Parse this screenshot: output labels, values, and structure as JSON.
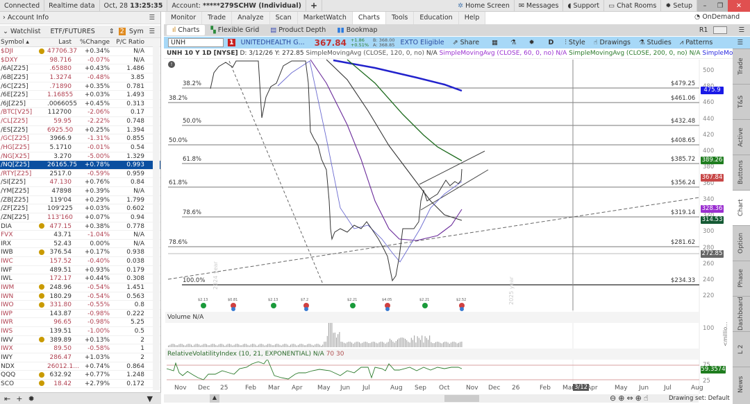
{
  "topbar": {
    "connected": "Connected",
    "realtime": "Realtime data",
    "date": "Oct, 28",
    "time": "13:25:35",
    "account_label": "Account:",
    "account": "*****279SCHW (Individual)",
    "home": "Home Screen",
    "messages": "Messages",
    "support": "Support",
    "chat": "Chat Rooms",
    "setup": "Setup"
  },
  "left": {
    "account_info": "Account Info",
    "watchlist": "Watchlist",
    "list_name": "ETF/FUTURES",
    "badge": "2",
    "sym": "Sym",
    "headers": [
      "Symbol ▴",
      "Last",
      "%Change",
      "P/C Ratio"
    ],
    "rows": [
      {
        "s": "$DJI",
        "b": true,
        "l": "47706.37",
        "c": "+0.34%",
        "p": "N/A",
        "lr": 1,
        "sr": 1
      },
      {
        "s": "$DXY",
        "b": false,
        "l": "98.716",
        "c": "-0.07%",
        "p": "N/A",
        "lr": 1,
        "sr": 1
      },
      {
        "s": "/6A[Z25]",
        "b": false,
        "l": ".65880",
        "c": "+0.43%",
        "p": "1.486",
        "lr": 1,
        "sr": 0
      },
      {
        "s": "/6B[Z25]",
        "b": false,
        "l": "1.3274",
        "c": "-0.48%",
        "p": "3.85",
        "lr": 1,
        "sr": 0
      },
      {
        "s": "/6C[Z25]",
        "b": false,
        "l": ".71890",
        "c": "+0.35%",
        "p": "0.781",
        "lr": 1,
        "sr": 0
      },
      {
        "s": "/6E[Z25]",
        "b": false,
        "l": "1.16855",
        "c": "+0.03%",
        "p": "1.493",
        "lr": 1,
        "sr": 0
      },
      {
        "s": "/6J[Z25]",
        "b": false,
        "l": ".0066055",
        "c": "+0.45%",
        "p": "0.313",
        "lr": 0,
        "sr": 0
      },
      {
        "s": "/BTC[V25]",
        "b": false,
        "l": "112700",
        "c": "-2.06%",
        "p": "0.17",
        "lr": 0,
        "sr": 1
      },
      {
        "s": "/CL[Z25]",
        "b": false,
        "l": "59.95",
        "c": "-2.22%",
        "p": "0.748",
        "lr": 1,
        "sr": 1
      },
      {
        "s": "/ES[Z25]",
        "b": false,
        "l": "6925.50",
        "c": "+0.25%",
        "p": "1.394",
        "lr": 1,
        "sr": 0
      },
      {
        "s": "/GC[Z25]",
        "b": false,
        "l": "3966.9",
        "c": "-1.31%",
        "p": "0.855",
        "lr": 0,
        "sr": 1
      },
      {
        "s": "/HG[Z25]",
        "b": false,
        "l": "5.1710",
        "c": "-0.01%",
        "p": "0.54",
        "lr": 0,
        "sr": 1
      },
      {
        "s": "/NG[X25]",
        "b": false,
        "l": "3.270",
        "c": "-5.00%",
        "p": "1.329",
        "lr": 0,
        "sr": 1
      },
      {
        "s": "/NQ[Z25]",
        "b": false,
        "l": "26165.75",
        "c": "+0.78%",
        "p": "0.993",
        "lr": 0,
        "sr": 0,
        "sel": true
      },
      {
        "s": "/RTY[Z25]",
        "b": false,
        "l": "2517.0",
        "c": "-0.59%",
        "p": "0.959",
        "lr": 0,
        "sr": 1
      },
      {
        "s": "/SI[Z25]",
        "b": false,
        "l": "47.130",
        "c": "+0.76%",
        "p": "0.84",
        "lr": 1,
        "sr": 0
      },
      {
        "s": "/YM[Z25]",
        "b": false,
        "l": "47898",
        "c": "+0.39%",
        "p": "N/A",
        "lr": 0,
        "sr": 0
      },
      {
        "s": "/ZB[Z25]",
        "b": false,
        "l": "119'04",
        "c": "+0.29%",
        "p": "1.799",
        "lr": 0,
        "sr": 0
      },
      {
        "s": "/ZF[Z25]",
        "b": false,
        "l": "109'225",
        "c": "+0.03%",
        "p": "0.602",
        "lr": 0,
        "sr": 0
      },
      {
        "s": "/ZN[Z25]",
        "b": false,
        "l": "113'160",
        "c": "+0.07%",
        "p": "0.94",
        "lr": 1,
        "sr": 0
      },
      {
        "s": "DIA",
        "b": true,
        "l": "477.15",
        "c": "+0.38%",
        "p": "0.778",
        "lr": 1,
        "sr": 0
      },
      {
        "s": "FVX",
        "b": false,
        "l": "43.71",
        "c": "-1.04%",
        "p": "N/A",
        "lr": 0,
        "sr": 1
      },
      {
        "s": "IRX",
        "b": false,
        "l": "52.43",
        "c": "0.00%",
        "p": "N/A",
        "lr": 0,
        "sr": 0
      },
      {
        "s": "IWB",
        "b": true,
        "l": "376.54",
        "c": "+0.17%",
        "p": "0.938",
        "lr": 0,
        "sr": 0
      },
      {
        "s": "IWC",
        "b": false,
        "l": "157.52",
        "c": "-0.40%",
        "p": "0.038",
        "lr": 1,
        "sr": 1
      },
      {
        "s": "IWF",
        "b": false,
        "l": "489.51",
        "c": "+0.93%",
        "p": "0.179",
        "lr": 0,
        "sr": 0
      },
      {
        "s": "IWL",
        "b": false,
        "l": "172.17",
        "c": "+0.44%",
        "p": "0.308",
        "lr": 1,
        "sr": 0
      },
      {
        "s": "IWM",
        "b": true,
        "l": "248.96",
        "c": "-0.54%",
        "p": "1.451",
        "lr": 0,
        "sr": 1
      },
      {
        "s": "IWN",
        "b": true,
        "l": "180.29",
        "c": "-0.54%",
        "p": "0.563",
        "lr": 0,
        "sr": 1
      },
      {
        "s": "IWO",
        "b": true,
        "l": "331.80",
        "c": "-0.55%",
        "p": "0.8",
        "lr": 1,
        "sr": 1
      },
      {
        "s": "IWP",
        "b": false,
        "l": "143.87",
        "c": "-0.98%",
        "p": "0.222",
        "lr": 0,
        "sr": 1
      },
      {
        "s": "IWR",
        "b": false,
        "l": "96.65",
        "c": "-0.98%",
        "p": "5.25",
        "lr": 1,
        "sr": 1
      },
      {
        "s": "IWS",
        "b": false,
        "l": "139.51",
        "c": "-1.00%",
        "p": "0.5",
        "lr": 0,
        "sr": 1
      },
      {
        "s": "IWV",
        "b": true,
        "l": "389.89",
        "c": "+0.13%",
        "p": "2",
        "lr": 0,
        "sr": 0
      },
      {
        "s": "IWX",
        "b": false,
        "l": "89.50",
        "c": "-0.58%",
        "p": "1",
        "lr": 1,
        "sr": 1
      },
      {
        "s": "IWY",
        "b": false,
        "l": "286.47",
        "c": "+1.03%",
        "p": "2",
        "lr": 1,
        "sr": 0
      },
      {
        "s": "NDX",
        "b": false,
        "l": "26012.1...",
        "c": "+0.74%",
        "p": "0.864",
        "lr": 1,
        "sr": 0
      },
      {
        "s": "QQQ",
        "b": true,
        "l": "632.92",
        "c": "+0.77%",
        "p": "1.248",
        "lr": 0,
        "sr": 0
      },
      {
        "s": "SCO",
        "b": true,
        "l": "18.42",
        "c": "+2.79%",
        "p": "0.172",
        "lr": 1,
        "sr": 0
      }
    ]
  },
  "tabs": [
    "Monitor",
    "Trade",
    "Analyze",
    "Scan",
    "MarketWatch",
    "Charts",
    "Tools",
    "Education",
    "Help"
  ],
  "ondemand": "OnDemand",
  "subtabs": [
    "Charts",
    "Flexible Grid",
    "Product Depth",
    "Bookmap"
  ],
  "r1": "R1",
  "symbar": {
    "symbol": "UNH",
    "alert": "1",
    "name": "UNITEDHEALTH G...",
    "price": "367.84",
    "chg": "+1.86",
    "pct": "+0.51%",
    "bid": "B: 368.00",
    "ask": "A: 368.85",
    "exto": "EXTO Eligible",
    "share": "Share",
    "period": "D",
    "style": "Style",
    "drawings": "Drawings",
    "studies": "Studies",
    "patterns": "Patterns"
  },
  "study": {
    "title": "UNH 10 Y 1D [NYSE]",
    "d": "D: 3/12/26",
    "y": "Y: 272.85",
    "s1": "SimpleMovingAvg (CLOSE, 120, 0, no)",
    "v1": "N/A",
    "s2": "SimpleMovingAvg (CLOSE, 60, 0, no)",
    "v2": "N/A",
    "s3": "SimpleMovingAvg (CLOSE, 200, 0, no)",
    "v3": "N/A",
    "s4": "SimpleMoving..."
  },
  "fib_prices": [
    "$479.25",
    "$461.06",
    "$432.48",
    "$408.65",
    "$385.72",
    "$356.24",
    "$319.14",
    "$281.62",
    "$234.33"
  ],
  "fib_pcts": [
    "38.2%",
    "38.2%",
    "50.0%",
    "50.0%",
    "61.8%",
    "61.8%",
    "78.6%",
    "78.6%",
    "100.0%"
  ],
  "axis": [
    "500",
    "480",
    "460",
    "440",
    "420",
    "400",
    "380",
    "360",
    "340",
    "320",
    "300",
    "280",
    "260",
    "240",
    "220"
  ],
  "badges": [
    {
      "v": "475.9",
      "c": "#1a1ae6"
    },
    {
      "v": "389.26",
      "c": "#1f7d1f"
    },
    {
      "v": "367.84",
      "c": "#c84848"
    },
    {
      "v": "328.36",
      "c": "#9a2fd0"
    },
    {
      "v": "314.53",
      "c": "#155a34"
    },
    {
      "v": "272.85",
      "c": "#666666"
    }
  ],
  "events": [
    "$2.13",
    "$0.81",
    "$2.13",
    "$7.2",
    "$2.21",
    "$4.05",
    "$2.21",
    "$2.52"
  ],
  "year_marks": [
    "2024 year",
    "2025 year"
  ],
  "volume": {
    "label": "Volume",
    "val": "N/A",
    "axis": "100",
    "unit": "<millio..."
  },
  "rvi": {
    "label": "RelativeVolatilityIndex (10, 21, EXPONENTIAL)",
    "val": "N/A",
    "hi": "70",
    "lo": "30",
    "axis_hi": "75",
    "axis_lo": "25",
    "badge": "59.3574"
  },
  "months": [
    "Nov",
    "Dec",
    "25",
    "Feb",
    "Mar",
    "Apr",
    "May",
    "Jun",
    "Jul",
    "Aug",
    "Sep",
    "Oct",
    "Nov",
    "Dec",
    "26",
    "Feb",
    "Mar",
    "Apr",
    "May",
    "Jun",
    "Jul",
    "Aug"
  ],
  "cursor_date": "3/12",
  "drawing_set": "Drawing set: Default",
  "side_tabs": [
    "Trade",
    "T&S",
    "Active Trader",
    "Buttons",
    "Chart",
    "Option Chain",
    "Phase Scores",
    "Dashboard",
    "L 2",
    "News"
  ]
}
